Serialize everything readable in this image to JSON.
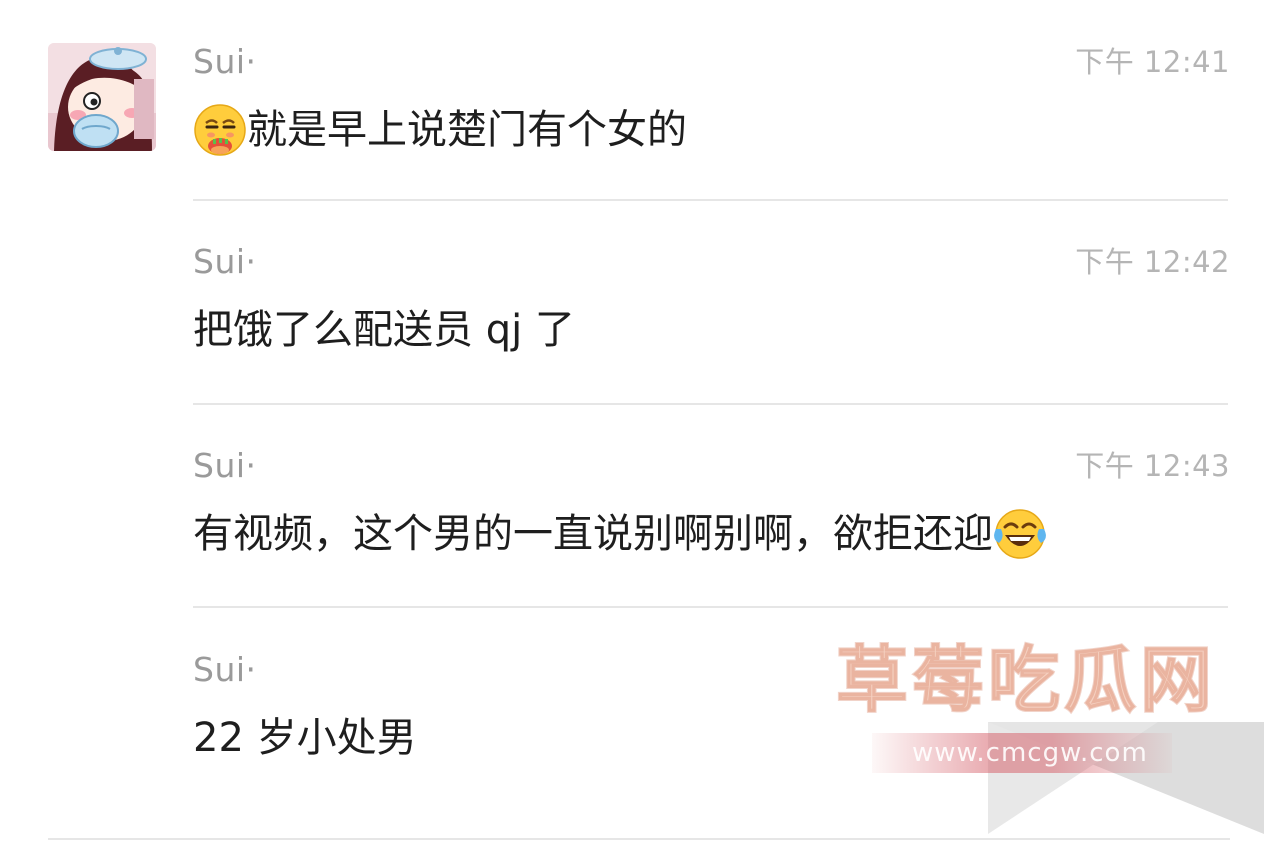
{
  "colors": {
    "background": "#ffffff",
    "sender_text": "#9a9a9a",
    "time_text": "#b5b5b5",
    "message_text": "#1e1e1e",
    "divider": "#e6e6e6",
    "watermark": "#ecaa8c"
  },
  "messages": [
    {
      "sender": "Sui·",
      "time": "下午 12:41",
      "leading_emoji": "smirk-emoji",
      "text": "就是早上说楚门有个女的",
      "trailing_emoji": ""
    },
    {
      "sender": "Sui·",
      "time": "下午 12:42",
      "leading_emoji": "",
      "text": "把饿了么配送员 qj 了",
      "trailing_emoji": ""
    },
    {
      "sender": "Sui·",
      "time": "下午 12:43",
      "leading_emoji": "",
      "text": "有视频，这个男的一直说别啊别啊，欲拒还迎",
      "trailing_emoji": "tears-of-joy-emoji"
    },
    {
      "sender": "Sui·",
      "time": "",
      "leading_emoji": "",
      "text": "22 岁小处男",
      "trailing_emoji": ""
    }
  ],
  "avatar": {
    "icon": "cartoon-girl-avatar"
  },
  "watermark": {
    "title": "草莓吃瓜网",
    "url": "www.cmcgw.com"
  }
}
